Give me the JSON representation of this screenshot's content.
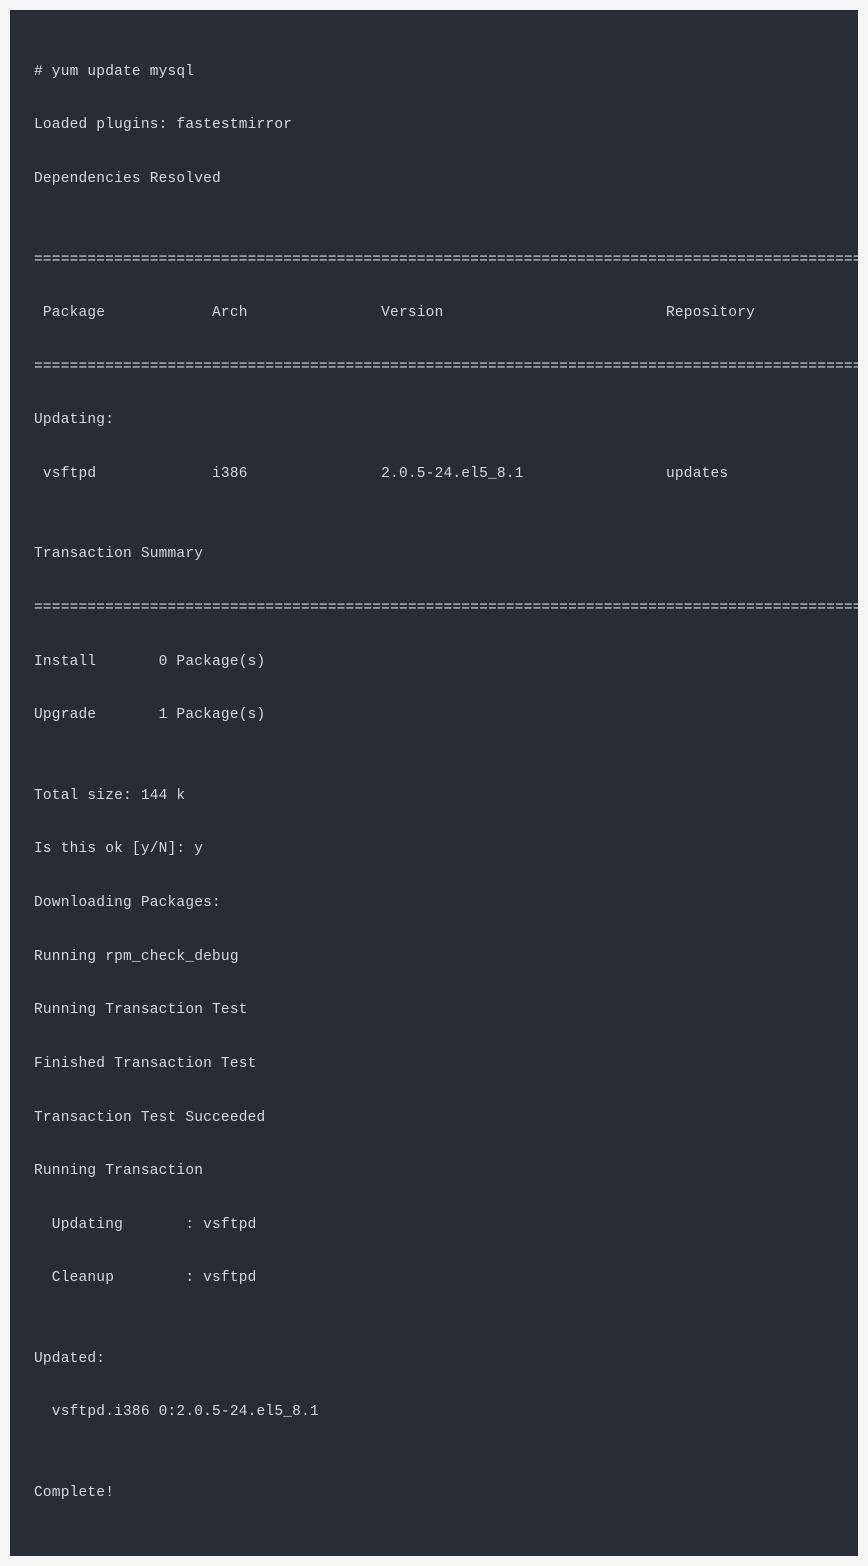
{
  "terminal": {
    "command": "# yum update mysql",
    "loaded_plugins": "Loaded plugins: fastestmirror",
    "deps_resolved": "Dependencies Resolved",
    "blank": "",
    "divider": "================================================================================================",
    "header_row": " Package            Arch               Version                         Repository",
    "updating_label": "Updating:",
    "package_row": " vsftpd             i386               2.0.5-24.el5_8.1                updates",
    "tx_summary": "Transaction Summary",
    "install_row": "Install       0 Package(s)",
    "upgrade_row": "Upgrade       1 Package(s)",
    "total_size": "Total size: 144 k",
    "confirm": "Is this ok [y/N]: y",
    "downloading": "Downloading Packages:",
    "rpm_check": "Running rpm_check_debug",
    "tx_test_run": "Running Transaction Test",
    "tx_test_fin": "Finished Transaction Test",
    "tx_test_ok": "Transaction Test Succeeded",
    "tx_run": "Running Transaction",
    "updating_pkg": "  Updating       : vsftpd",
    "cleanup_pkg": "  Cleanup        : vsftpd",
    "updated_label": "Updated:",
    "updated_pkg": "  vsftpd.i386 0:2.0.5-24.el5_8.1",
    "complete": "Complete!"
  }
}
